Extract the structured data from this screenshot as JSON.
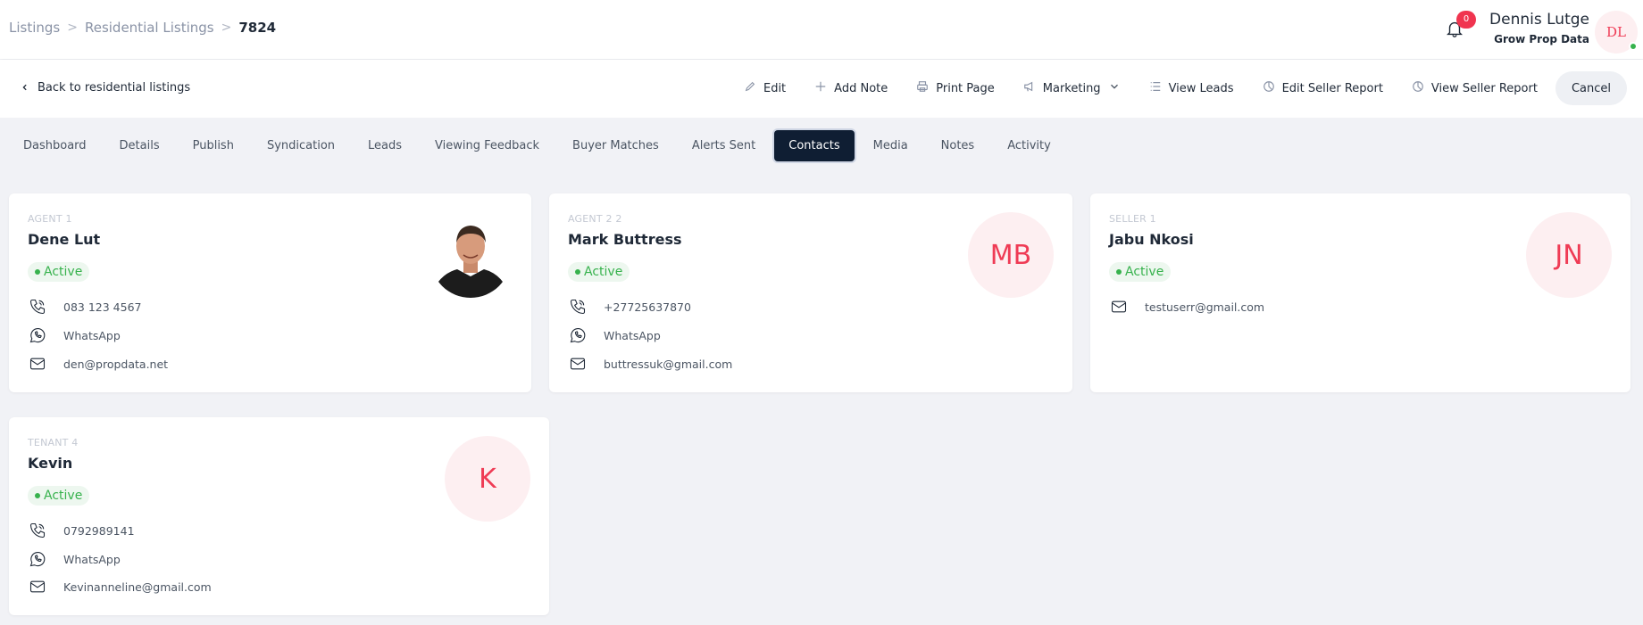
{
  "breadcrumb": {
    "items": [
      "Listings",
      "Residential Listings"
    ],
    "current": "7824"
  },
  "notifications": {
    "count": "0"
  },
  "user": {
    "name": "Dennis Lutge",
    "company": "Grow Prop Data",
    "initials": "DL"
  },
  "actionbar": {
    "back_label": "Back to residential listings",
    "edit": "Edit",
    "add_note": "Add Note",
    "print_page": "Print Page",
    "marketing": "Marketing",
    "view_leads": "View Leads",
    "edit_seller_report": "Edit Seller Report",
    "view_seller_report": "View Seller Report",
    "cancel": "Cancel"
  },
  "tabs": [
    "Dashboard",
    "Details",
    "Publish",
    "Syndication",
    "Leads",
    "Viewing Feedback",
    "Buyer Matches",
    "Alerts Sent",
    "Contacts",
    "Media",
    "Notes",
    "Activity"
  ],
  "active_tab": "Contacts",
  "contacts": [
    {
      "role": "AGENT 1",
      "name": "Dene Lut",
      "status": "Active",
      "phone": "083 123 4567",
      "whatsapp": "WhatsApp",
      "email": "den@propdata.net",
      "avatar": "photo"
    },
    {
      "role": "AGENT 2 2",
      "name": "Mark Buttress",
      "status": "Active",
      "phone": "+27725637870",
      "whatsapp": "WhatsApp",
      "email": "buttressuk@gmail.com",
      "initials": "MB"
    },
    {
      "role": "SELLER 1",
      "name": "Jabu Nkosi",
      "status": "Active",
      "email": "testuserr@gmail.com",
      "initials": "JN"
    },
    {
      "role": "TENANT 4",
      "name": "Kevin",
      "status": "Active",
      "phone": "0792989141",
      "whatsapp": "WhatsApp",
      "email": "Kevinanneline@gmail.com",
      "initials": "K"
    }
  ],
  "colors": {
    "accent": "#ef3b55",
    "active_green": "#37b24d",
    "tab_active_bg": "#0f1e33",
    "page_bg": "#f1f2f6"
  }
}
